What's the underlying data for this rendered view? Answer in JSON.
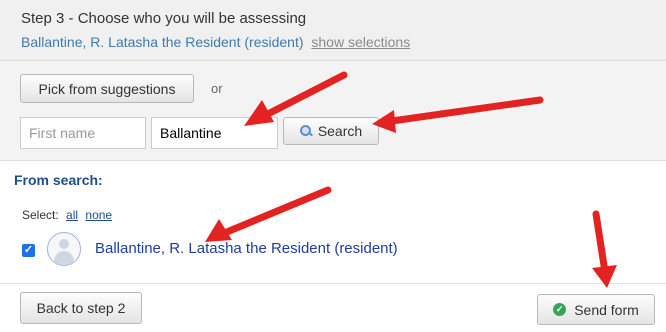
{
  "header": {
    "step_title": "Step 3 - Choose who you will be assessing",
    "selected_resident": "Ballantine, R. Latasha the Resident (resident)",
    "show_selections_label": "show selections"
  },
  "search_panel": {
    "pick_button_label": "Pick from suggestions",
    "or_label": "or",
    "first_name_placeholder": "First name",
    "last_name_value": "Ballantine",
    "search_button_label": "Search"
  },
  "results": {
    "heading": "From search:",
    "select_label": "Select:",
    "select_all_label": "all",
    "select_none_label": "none",
    "items": [
      {
        "name": "Ballantine, R. Latasha the Resident (resident)",
        "checked": true
      }
    ]
  },
  "footer": {
    "back_button_label": "Back to step 2",
    "send_button_label": "Send form"
  },
  "colors": {
    "annotation_arrow": "#e32222",
    "link_blue": "#1f4e8c",
    "send_icon_green": "#3aa35b"
  }
}
